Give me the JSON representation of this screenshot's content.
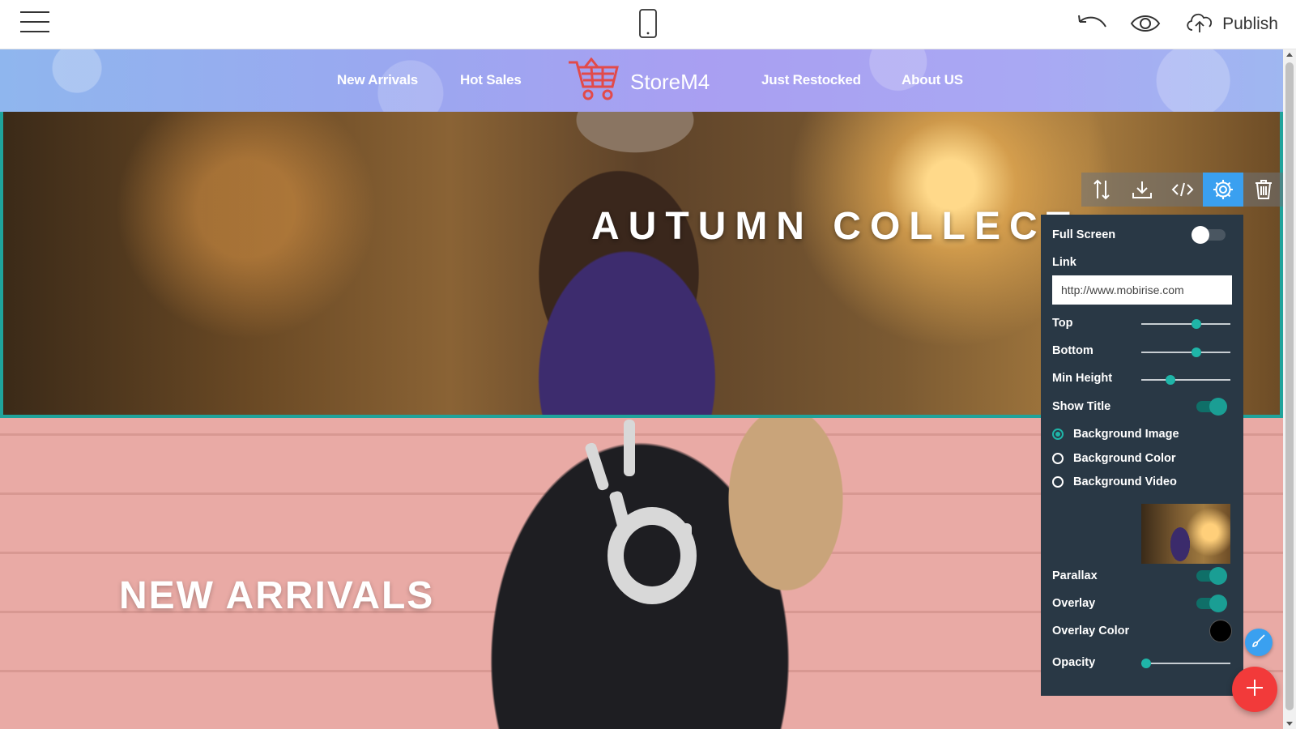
{
  "toolbar": {
    "menu_icon": "hamburger-menu-icon",
    "device_icon": "mobile-phone-icon",
    "undo_icon": "undo-icon",
    "preview_icon": "eye-icon",
    "publish_icon": "cloud-upload-icon",
    "publish_label": "Publish"
  },
  "site": {
    "nav_links": [
      "New Arrivals",
      "Hot Sales",
      "Just Restocked",
      "About US"
    ],
    "brand_name": "StoreM4",
    "brand_icon": "shopping-cart-icon",
    "hero_title": "AUTUMN COLLECT",
    "arrivals_title": "NEW ARRIVALS"
  },
  "block_toolbar": {
    "buttons": [
      "reorder-icon",
      "download-icon",
      "code-icon",
      "gear-icon",
      "trash-icon"
    ],
    "active": "gear-icon"
  },
  "settings": {
    "full_screen": {
      "label": "Full Screen",
      "on": false
    },
    "link": {
      "label": "Link",
      "value": "http://www.mobirise.com"
    },
    "top": {
      "label": "Top",
      "value": 0.62
    },
    "bottom": {
      "label": "Bottom",
      "value": 0.62
    },
    "min_height": {
      "label": "Min Height",
      "value": 0.33
    },
    "show_title": {
      "label": "Show Title",
      "on": true
    },
    "background_options": [
      "Background Image",
      "Background Color",
      "Background Video"
    ],
    "background_selected": "Background Image",
    "parallax": {
      "label": "Parallax",
      "on": true
    },
    "overlay": {
      "label": "Overlay",
      "on": true
    },
    "overlay_color": {
      "label": "Overlay Color",
      "value": "#000000"
    },
    "opacity": {
      "label": "Opacity",
      "value": 0.05
    }
  },
  "floating": {
    "brush_icon": "paint-brush-icon",
    "add_icon": "plus-icon"
  },
  "colors": {
    "accent_teal": "#1fa39b",
    "panel_bg": "#293845",
    "active_blue": "#3aa0f0",
    "add_red": "#f23a3a"
  }
}
